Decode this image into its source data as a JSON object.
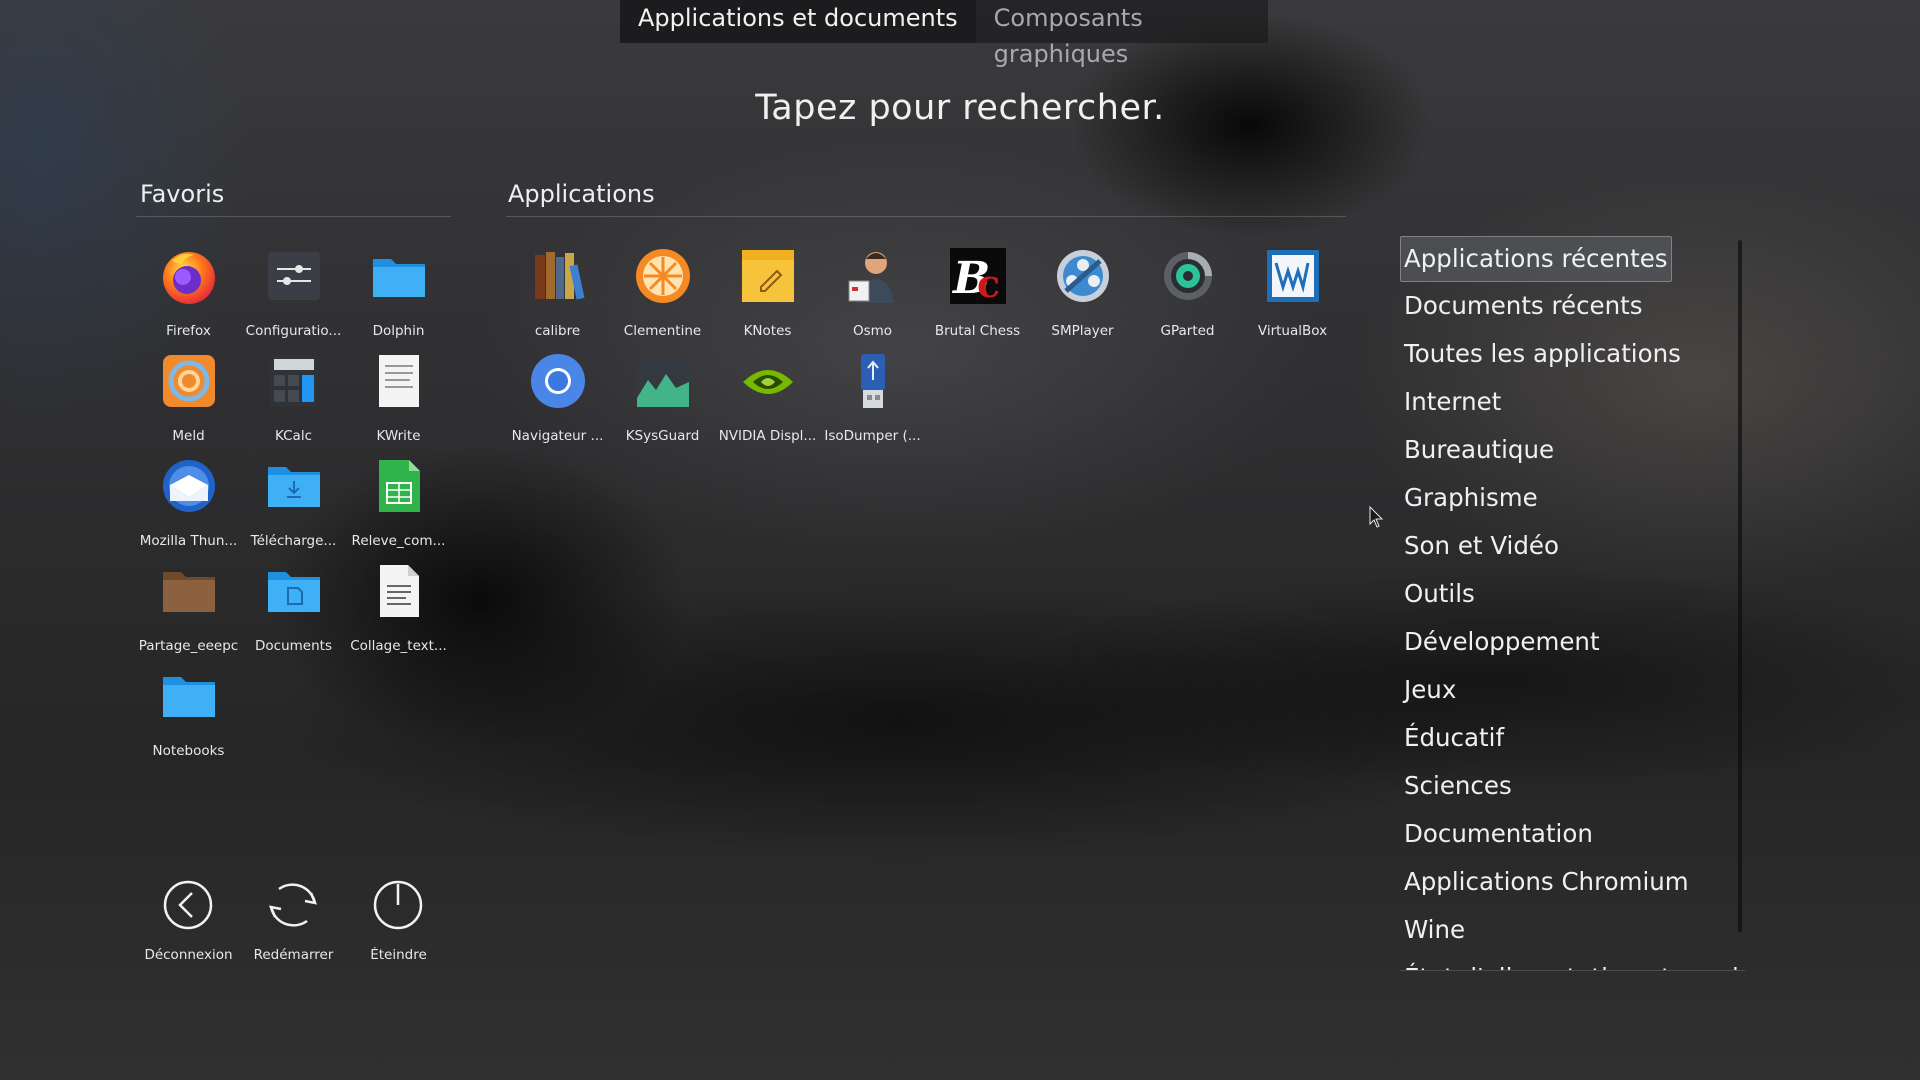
{
  "tabs": [
    {
      "label": "Applications et documents",
      "active": true
    },
    {
      "label": "Composants graphiques",
      "active": false
    }
  ],
  "search_hint": "Tapez pour rechercher.",
  "favorites": {
    "title": "Favoris",
    "items": [
      {
        "label": "Firefox",
        "icon": "firefox-icon"
      },
      {
        "label": "Configuratio...",
        "icon": "settings-icon"
      },
      {
        "label": "Dolphin",
        "icon": "folder-icon"
      },
      {
        "label": "Meld",
        "icon": "meld-icon"
      },
      {
        "label": "KCalc",
        "icon": "calculator-icon"
      },
      {
        "label": "KWrite",
        "icon": "text-editor-icon"
      },
      {
        "label": "Mozilla Thun...",
        "icon": "thunderbird-icon"
      },
      {
        "label": "Télécharge...",
        "icon": "downloads-folder-icon"
      },
      {
        "label": "Releve_com...",
        "icon": "spreadsheet-icon"
      },
      {
        "label": "Partage_eeepc",
        "icon": "brown-folder-icon"
      },
      {
        "label": "Documents",
        "icon": "documents-folder-icon"
      },
      {
        "label": "Collage_text...",
        "icon": "text-file-icon"
      },
      {
        "label": "Notebooks",
        "icon": "folder-icon"
      }
    ]
  },
  "applications": {
    "title": "Applications",
    "items": [
      {
        "label": "calibre",
        "icon": "calibre-icon"
      },
      {
        "label": "Clementine",
        "icon": "clementine-icon"
      },
      {
        "label": "KNotes",
        "icon": "knotes-icon"
      },
      {
        "label": "Osmo",
        "icon": "osmo-icon"
      },
      {
        "label": "Brutal Chess",
        "icon": "brutal-chess-icon"
      },
      {
        "label": "SMPlayer",
        "icon": "smplayer-icon"
      },
      {
        "label": "GParted",
        "icon": "gparted-icon"
      },
      {
        "label": "VirtualBox",
        "icon": "virtualbox-icon"
      },
      {
        "label": "Navigateur ...",
        "icon": "chromium-icon"
      },
      {
        "label": "KSysGuard",
        "icon": "ksysguard-icon"
      },
      {
        "label": "NVIDIA Displ...",
        "icon": "nvidia-icon"
      },
      {
        "label": "IsoDumper (...",
        "icon": "usb-drive-icon"
      }
    ]
  },
  "power": [
    {
      "label": "Déconnexion",
      "icon": "logout-icon"
    },
    {
      "label": "Redémarrer",
      "icon": "restart-icon"
    },
    {
      "label": "Éteindre",
      "icon": "shutdown-icon"
    }
  ],
  "categories": [
    {
      "label": "Applications récentes",
      "selected": true
    },
    {
      "label": "Documents récents"
    },
    {
      "label": "Toutes les applications"
    },
    {
      "label": "Internet"
    },
    {
      "label": "Bureautique"
    },
    {
      "label": "Graphisme"
    },
    {
      "label": "Son et Vidéo"
    },
    {
      "label": "Outils"
    },
    {
      "label": "Développement"
    },
    {
      "label": "Jeux"
    },
    {
      "label": "Éducatif"
    },
    {
      "label": "Sciences"
    },
    {
      "label": "Documentation"
    },
    {
      "label": "Applications Chromium"
    },
    {
      "label": "Wine"
    },
    {
      "label": "État d'alimentation et session"
    }
  ]
}
